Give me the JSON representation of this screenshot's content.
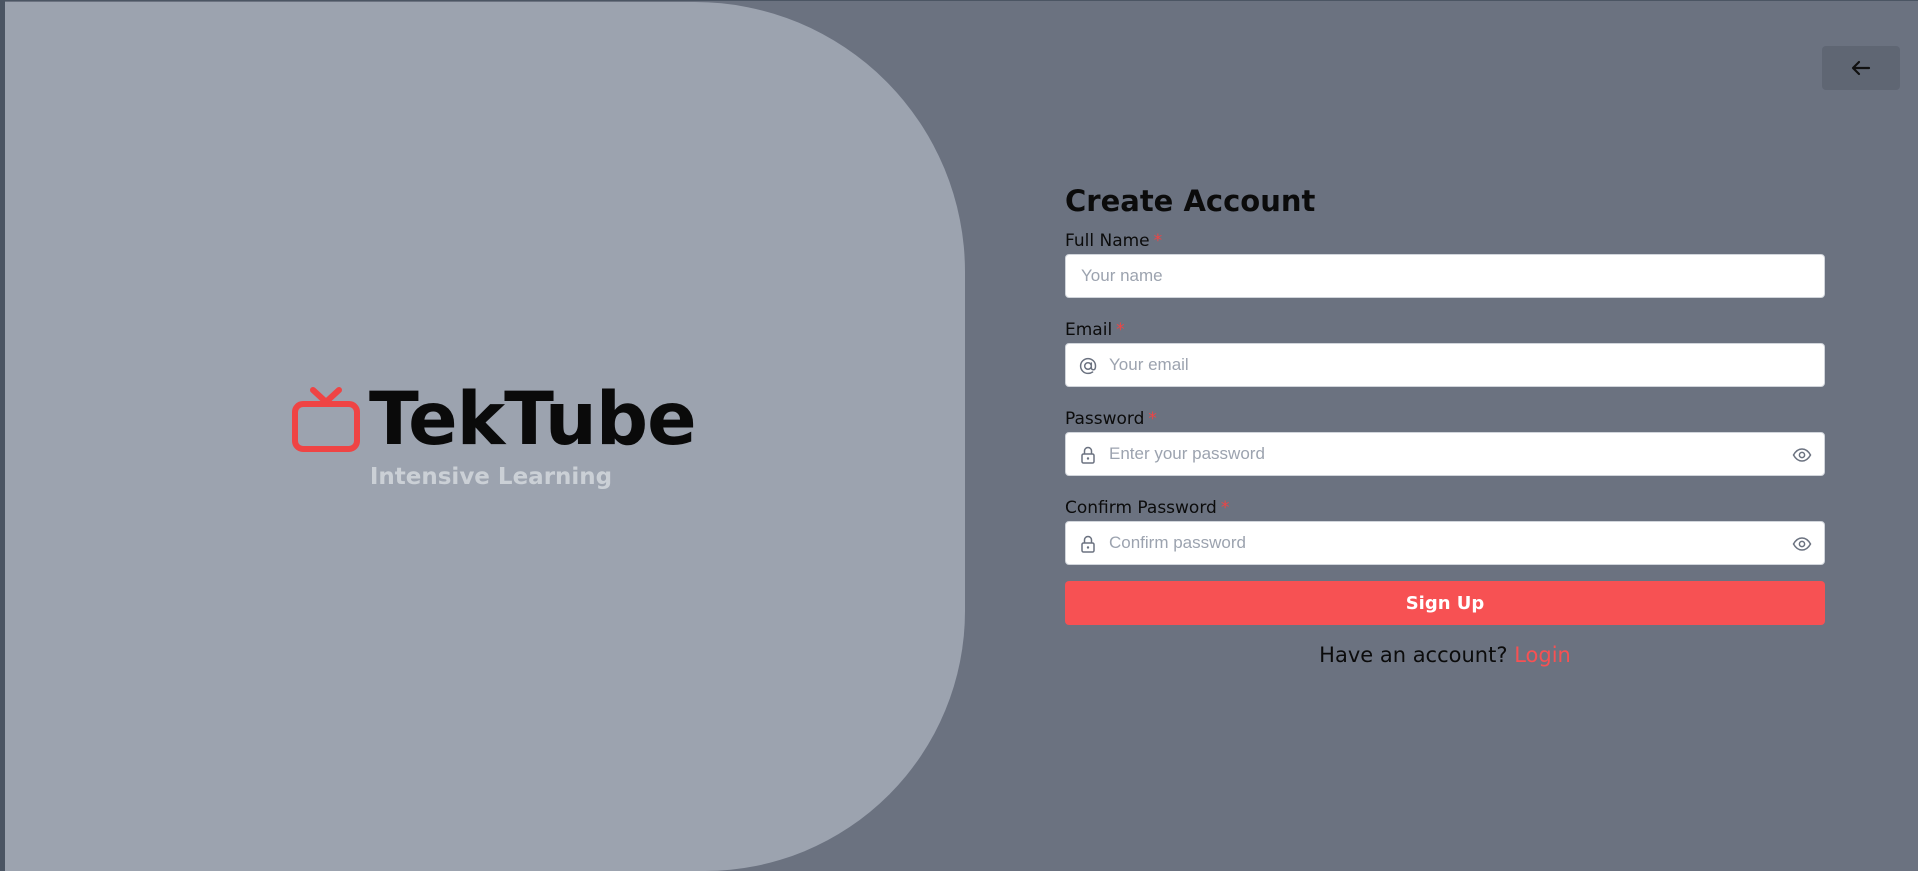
{
  "brand": {
    "name": "TekTube",
    "tagline": "Intensive Learning",
    "icon": "tv-icon",
    "accent_color": "#ef4444"
  },
  "back_button": {
    "icon": "arrow-left-icon"
  },
  "form": {
    "title": "Create Account",
    "required_marker": "*",
    "fields": [
      {
        "label": "Full Name",
        "placeholder": "Your name",
        "value": ""
      },
      {
        "label": "Email",
        "placeholder": "Your email",
        "value": "",
        "icon": "at-icon"
      },
      {
        "label": "Password",
        "placeholder": "Enter your password",
        "value": "",
        "icon": "lock-icon",
        "toggle_icon": "eye-icon"
      },
      {
        "label": "Confirm Password",
        "placeholder": "Confirm password",
        "value": "",
        "icon": "lock-icon",
        "toggle_icon": "eye-icon"
      }
    ],
    "submit_label": "Sign Up",
    "login_prompt": "Have an account?",
    "login_link": "Login"
  },
  "colors": {
    "page_background": "#6b7280",
    "hero_background": "#9ca3af",
    "primary_button": "#f75153"
  }
}
